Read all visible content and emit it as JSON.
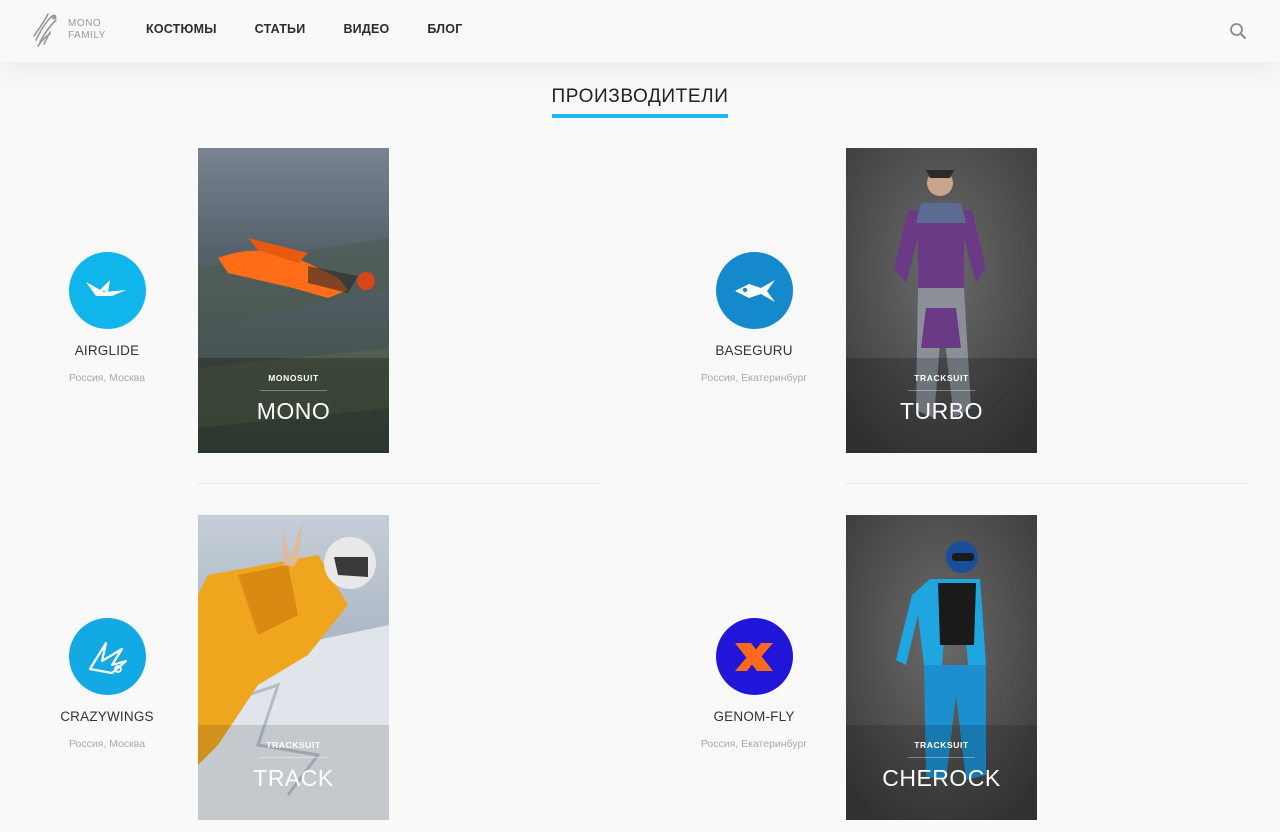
{
  "logo": {
    "line1": "MONO",
    "line2": "FAMILY"
  },
  "nav": {
    "items": [
      "КОСТЮМЫ",
      "СТАТЬИ",
      "ВИДЕО",
      "БЛОГ"
    ]
  },
  "search": {
    "icon": "search-icon"
  },
  "section": {
    "title": "ПРОИЗВОДИТЕЛИ"
  },
  "colors": {
    "accent": "#1fb6ec",
    "airglide": "#10b5ec",
    "baseguru": "#1489cc",
    "crazywings": "#13a9e4",
    "genomfly": "#1f16d9",
    "genomfly_mark": "#ff6a1a"
  },
  "manufacturers": [
    {
      "name": "AIRGLIDE",
      "location": "Россия, Москва",
      "icon": "airglide-logo-icon",
      "suit": {
        "type": "MONOSUIT",
        "name": "MONO"
      }
    },
    {
      "name": "BASEGURU",
      "location": "Россия, Екатеринбург",
      "icon": "baseguru-logo-icon",
      "suit": {
        "type": "TRACKSUIT",
        "name": "TURBO"
      }
    },
    {
      "name": "CRAZYWINGS",
      "location": "Россия, Москва",
      "icon": "crazywings-logo-icon",
      "suit": {
        "type": "TRACKSUIT",
        "name": "TRACK"
      }
    },
    {
      "name": "GENOM-FLY",
      "location": "Россия, Екатеринбург",
      "icon": "genomfly-logo-icon",
      "suit": {
        "type": "TRACKSUIT",
        "name": "CHEROCK"
      }
    }
  ]
}
